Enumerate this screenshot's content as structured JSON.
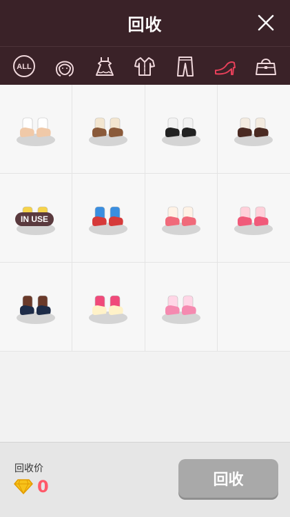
{
  "header": {
    "title": "回收"
  },
  "tabs": [
    {
      "icon": "all-icon",
      "label": "ALL"
    },
    {
      "icon": "face-hair-icon"
    },
    {
      "icon": "dress-icon"
    },
    {
      "icon": "shirt-icon"
    },
    {
      "icon": "pants-icon"
    },
    {
      "icon": "high-heel-icon"
    },
    {
      "icon": "bag-icon"
    }
  ],
  "selected_tab": "high-heel-icon",
  "items": [
    {
      "name": "shoes-cream-sandals",
      "colors": [
        "#f0c9a8",
        "#ffffff"
      ]
    },
    {
      "name": "shoes-leopard",
      "colors": [
        "#8a5a3a",
        "#f3e6d0"
      ]
    },
    {
      "name": "shoes-black-white-boots",
      "colors": [
        "#222222",
        "#f2f2f2"
      ]
    },
    {
      "name": "shoes-brown-loafers",
      "colors": [
        "#4a2a22",
        "#f3ebe0"
      ]
    },
    {
      "name": "shoes-purple-yellow-sandals",
      "colors": [
        "#9c7be0",
        "#f6d34a"
      ],
      "badge": "IN USE"
    },
    {
      "name": "shoes-stars-stripes",
      "colors": [
        "#d63a3a",
        "#3a8ee0"
      ]
    },
    {
      "name": "shoes-strawberry",
      "colors": [
        "#f06a7a",
        "#fff2e6"
      ]
    },
    {
      "name": "shoes-pink-bow",
      "colors": [
        "#f05a7a",
        "#ffd0da"
      ]
    },
    {
      "name": "shoes-navy-boots",
      "colors": [
        "#1e2c48",
        "#6a3a2a"
      ]
    },
    {
      "name": "shoes-cream-pink-bow",
      "colors": [
        "#fff2c8",
        "#f04a7a"
      ]
    },
    {
      "name": "shoes-pink-heels",
      "colors": [
        "#f58ab0",
        "#ffd6e6"
      ]
    },
    {
      "name": "",
      "colors": []
    }
  ],
  "footer": {
    "price_label": "回收价",
    "price_value": "0",
    "recycle_button": "回收"
  },
  "colors": {
    "header_bg": "#3a2228",
    "selected_tab": "#e8405a",
    "tab_icon": "#f0d8dc",
    "button_disabled": "#a9a9a9",
    "price": "#ff5a6a"
  }
}
